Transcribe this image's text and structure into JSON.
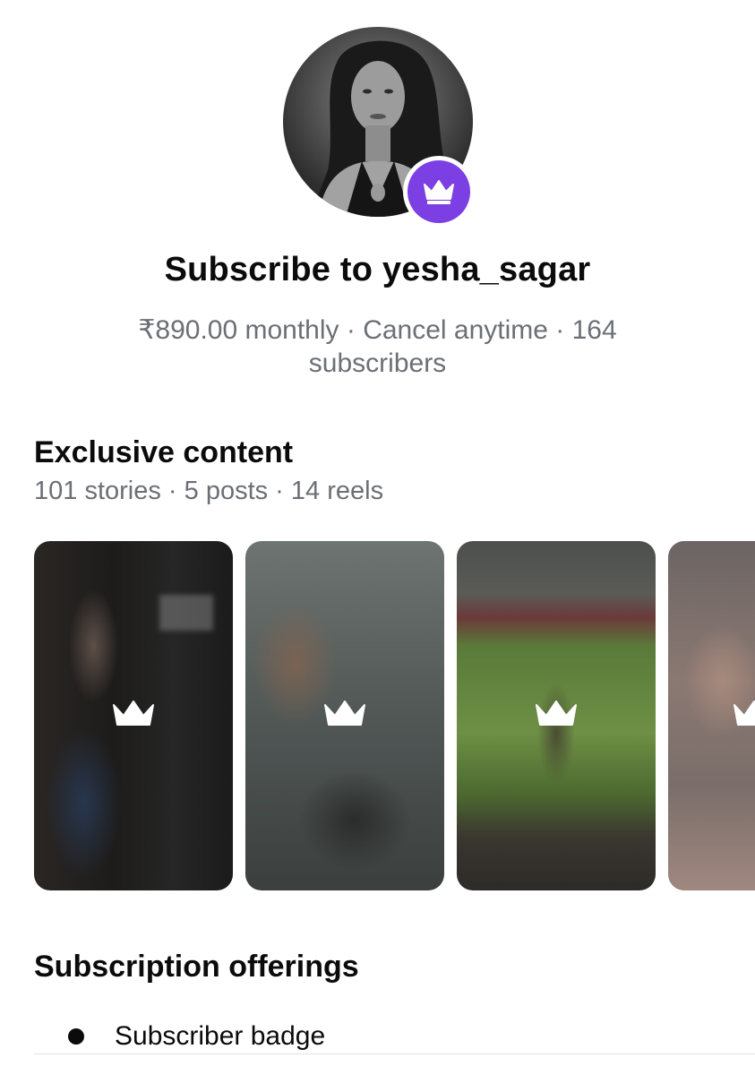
{
  "profile": {
    "avatar_alt": "yesha_sagar profile photo",
    "badge_icon": "crown-icon",
    "badge_color": "#7b3fe4"
  },
  "header": {
    "title": "Subscribe to yesha_sagar",
    "subtitle": "₹890.00 monthly · Cancel anytime · 164 subscribers"
  },
  "exclusive": {
    "heading": "Exclusive content",
    "counts": "101 stories · 5 posts · 14 reels",
    "thumbnails": [
      {
        "locked_icon": "crown-icon"
      },
      {
        "locked_icon": "crown-icon"
      },
      {
        "locked_icon": "crown-icon"
      },
      {
        "locked_icon": "crown-icon"
      }
    ]
  },
  "offerings": {
    "heading": "Subscription offerings",
    "items": [
      {
        "label": "Subscriber badge"
      }
    ]
  }
}
